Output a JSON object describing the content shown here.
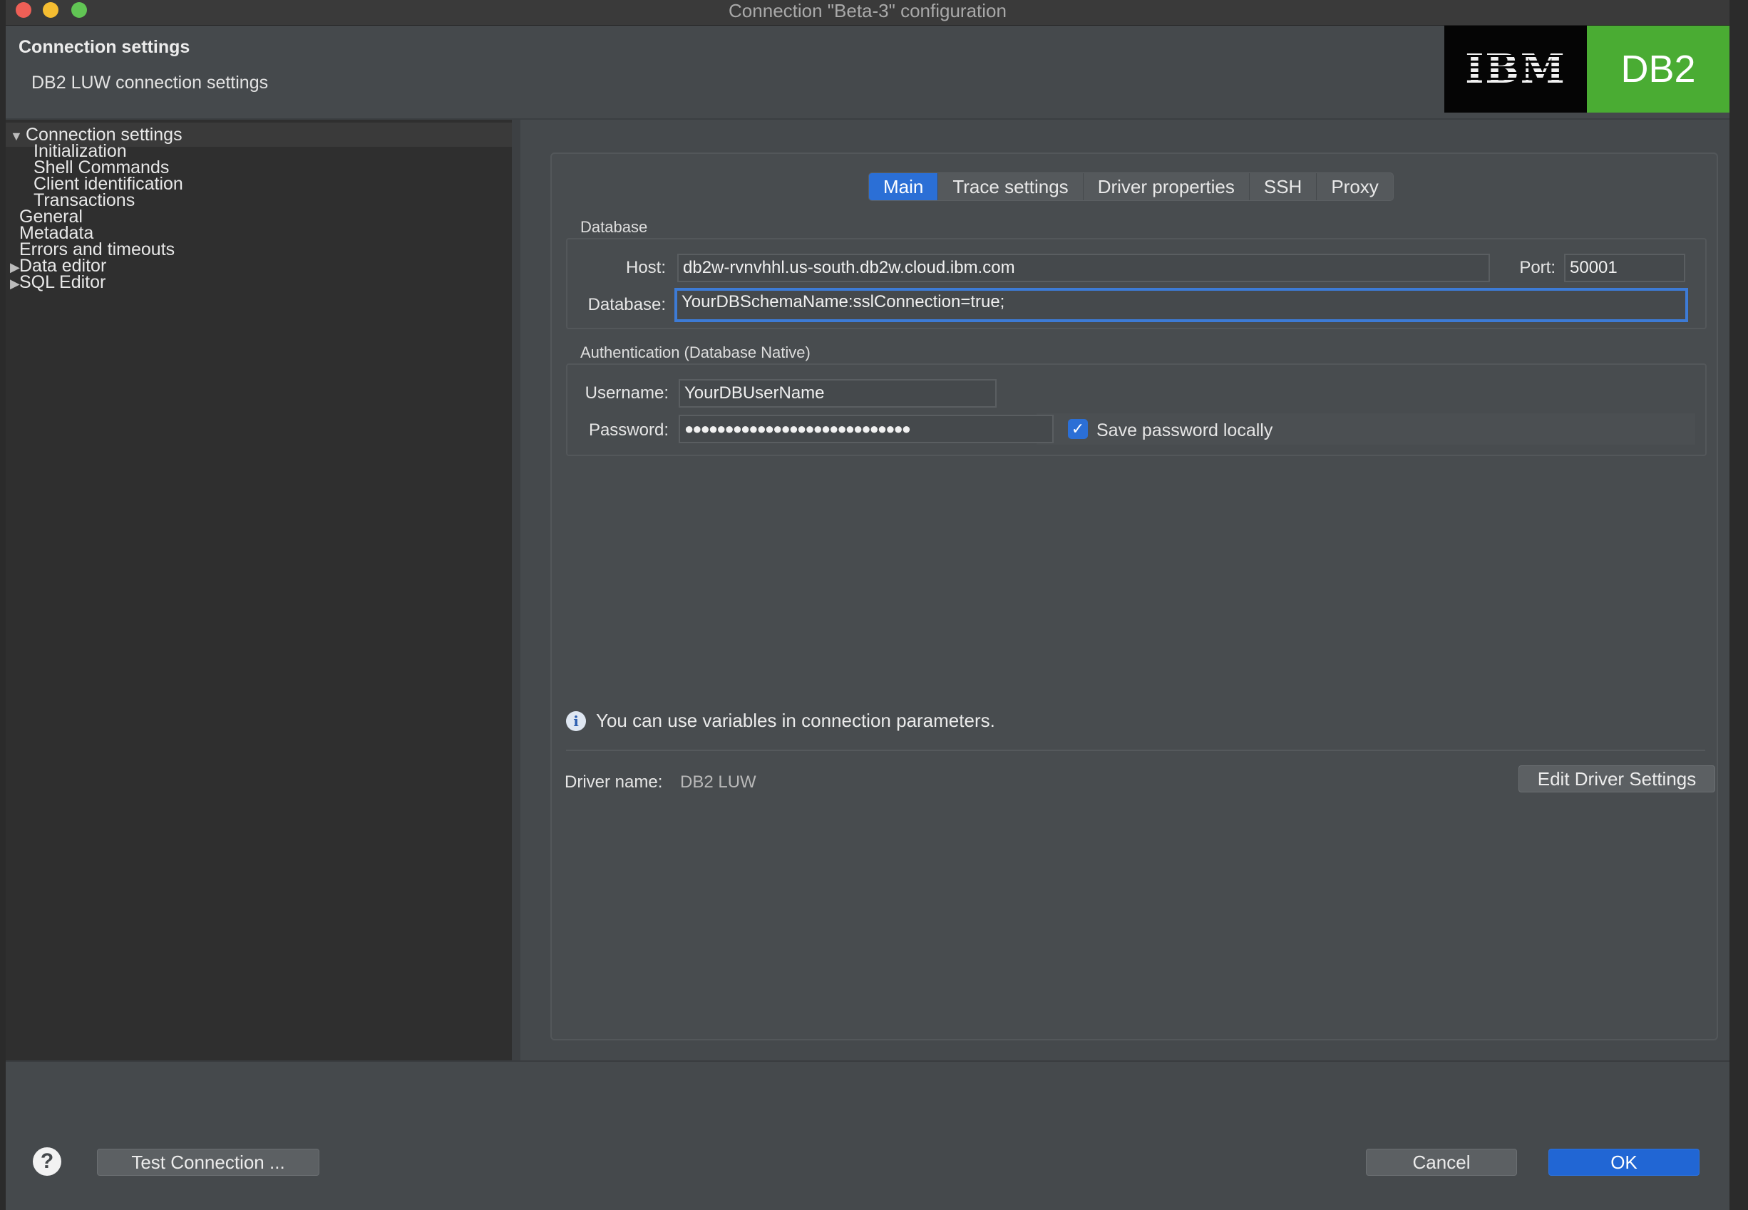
{
  "window": {
    "title": "Connection \"Beta-3\" configuration"
  },
  "header": {
    "title": "Connection settings",
    "subtitle": "DB2 LUW connection settings",
    "logo_left": "IBM",
    "logo_right": "DB2"
  },
  "tree": {
    "items": [
      {
        "label": "Connection settings",
        "expander": "▼"
      },
      {
        "label": "Initialization"
      },
      {
        "label": "Shell Commands"
      },
      {
        "label": "Client identification"
      },
      {
        "label": "Transactions"
      },
      {
        "label": "General"
      },
      {
        "label": "Metadata"
      },
      {
        "label": "Errors and timeouts"
      },
      {
        "label": "Data editor",
        "expander": "▶"
      },
      {
        "label": "SQL Editor",
        "expander": "▶"
      }
    ]
  },
  "tabs": [
    "Main",
    "Trace settings",
    "Driver properties",
    "SSH",
    "Proxy"
  ],
  "database_group": {
    "label": "Database",
    "host_label": "Host:",
    "host_value": "db2w-rvnvhhl.us-south.db2w.cloud.ibm.com",
    "port_label": "Port:",
    "port_value": "50001",
    "database_label": "Database:",
    "database_value": "YourDBSchemaName:sslConnection=true;"
  },
  "auth_group": {
    "label": "Authentication (Database Native)",
    "username_label": "Username:",
    "username_value": "YourDBUserName",
    "password_label": "Password:",
    "password_value": "●●●●●●●●●●●●●●●●●●●●●●●●●●●●",
    "save_password_label": "Save password locally",
    "save_password_checked": true
  },
  "info": {
    "text": "You can use variables in connection parameters."
  },
  "driver": {
    "label": "Driver name:",
    "value": "DB2 LUW",
    "edit_button": "Edit Driver Settings"
  },
  "footer": {
    "help": "?",
    "test_button": "Test Connection ...",
    "cancel_button": "Cancel",
    "ok_button": "OK"
  },
  "colors": {
    "accent": "#2166d4",
    "db2_green": "#4aac33"
  }
}
